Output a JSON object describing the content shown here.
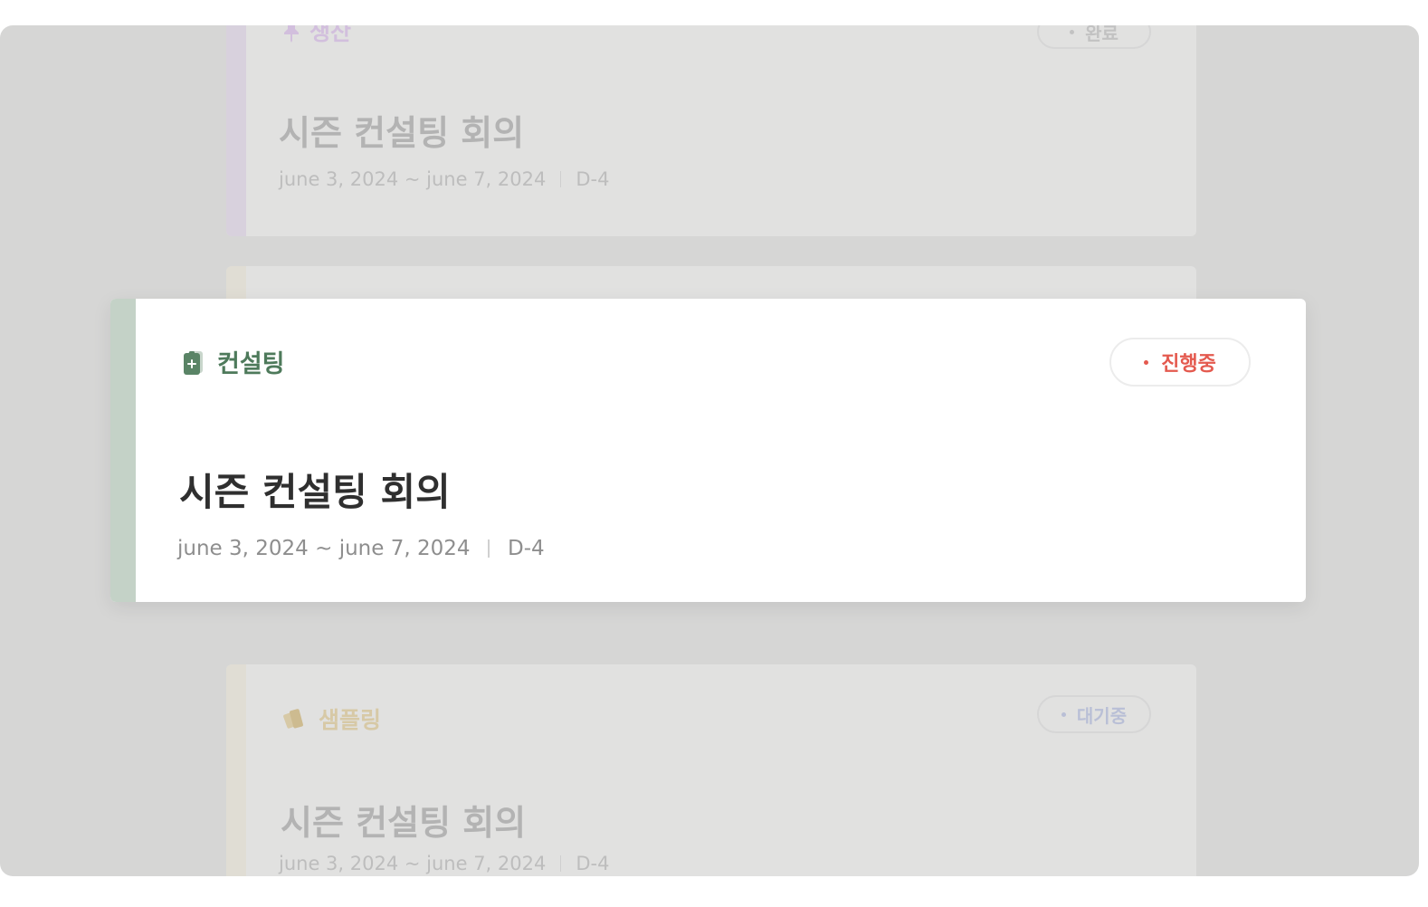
{
  "cards": [
    {
      "category": "생산",
      "category_icon": "pin-icon",
      "status": "완료",
      "title": "시즌 컨설팅 회의",
      "date_range": "june 3, 2024 ~ june 7, 2024",
      "dday": "D-4",
      "accent_color": "#d8d1dd"
    },
    {
      "category": "컨설팅",
      "category_icon": "clipboard-icon",
      "status": "진행중",
      "title": "시즌 컨설팅 회의",
      "date_range": "june 3, 2024 ~ june 7, 2024",
      "dday": "D-4",
      "accent_color": "#c4d2c7",
      "status_color": "#e45a4f"
    },
    {
      "category": "샘플링",
      "category_icon": "swatch-icon",
      "status": "대기중",
      "title": "시즌 컨설팅 회의",
      "date_range": "june 3, 2024 ~ june 7, 2024",
      "dday": "D-4",
      "accent_color": "#e0ddd4"
    }
  ]
}
